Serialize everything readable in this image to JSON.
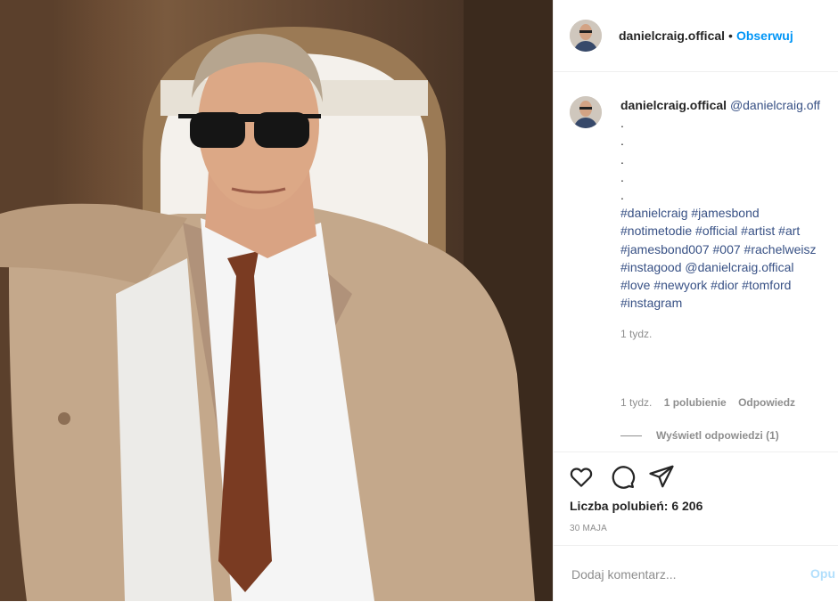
{
  "post": {
    "username": "danielcraig.offical",
    "follow_label": "Obserwuj",
    "separator": "•",
    "caption": {
      "username": "danielcraig.offical",
      "mention": "@danielcraig.off",
      "dots": [
        ".",
        ".",
        ".",
        ".",
        "."
      ],
      "hashtag_lines": [
        "#danielcraig #jamesbond",
        "#notimetodie #official #artist #art",
        "#jamesbond007 #007 #rachelweisz",
        "#instagood @danielcraig.offical",
        "#love #newyork #dior #tomford",
        "#instagram"
      ],
      "time": "1 tydz."
    },
    "comment": {
      "time": "1 tydz.",
      "likes": "1 polubienie",
      "reply_label": "Odpowiedz",
      "view_replies": "Wyświetl odpowiedzi (1)"
    },
    "actions": {
      "like_icon": "heart-icon",
      "comment_icon": "speech-bubble-icon",
      "share_icon": "paper-plane-icon"
    },
    "likes_text": "Liczba polubień: 6 206",
    "date": "30 MAJA",
    "add_comment": {
      "placeholder": "Dodaj komentarz...",
      "post_label": "Opu"
    },
    "colors": {
      "link_blue": "#0095f6",
      "hashtag_blue": "#385185",
      "muted": "#8e8e8e",
      "post_disabled": "#b2dffc"
    }
  }
}
